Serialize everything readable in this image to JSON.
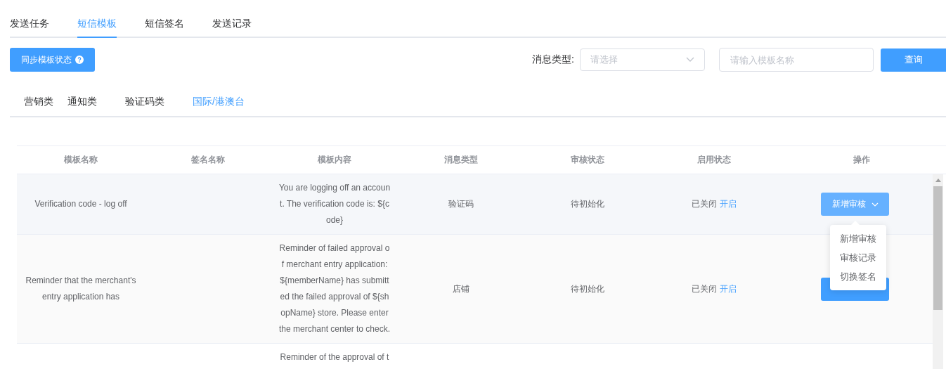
{
  "tabs": [
    {
      "label": "发送任务",
      "selected": false
    },
    {
      "label": "短信模板",
      "selected": true
    },
    {
      "label": "短信签名",
      "selected": false
    },
    {
      "label": "发送记录",
      "selected": false
    }
  ],
  "toolbar": {
    "sync_button": "同步模板状态",
    "filter_label": "消息类型:",
    "type_select": {
      "placeholder": "请选择"
    },
    "name_field": {
      "placeholder": "请输入模板名称"
    },
    "query_button": "查询"
  },
  "categories": [
    {
      "label": "营销类",
      "selected": false
    },
    {
      "label": "通知类",
      "selected": false
    },
    {
      "label": "验证码类",
      "selected": false
    },
    {
      "label": "国际/港澳台",
      "selected": true
    }
  ],
  "table": {
    "columns": [
      "模板名称",
      "签名名称",
      "模板内容",
      "消息类型",
      "审核状态",
      "启用状态",
      "操作"
    ],
    "rows": [
      {
        "name": "Verification code - log off",
        "content": "You are logging off an account. The verification code is: ${code}",
        "message_type": "验证码",
        "review_status": "待初始化",
        "enable_status": "已关闭",
        "enable_link": "开启",
        "action": "新增审核",
        "menu": [
          "新增审核",
          "审核记录",
          "切换签名"
        ]
      },
      {
        "name": "Reminder that the merchant's entry application has",
        "content": "Reminder of failed approval of merchant entry application: ${memberName} has submitted the failed approval of ${shopName} store. Please enter the merchant center to check.",
        "message_type": "店铺",
        "review_status": "待初始化",
        "enable_status": "已关闭",
        "enable_link": "开启"
      },
      {
        "content": "Reminder of the approval of t"
      }
    ]
  }
}
